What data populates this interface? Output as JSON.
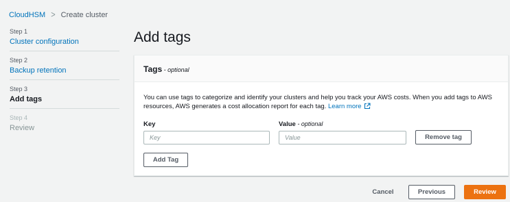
{
  "breadcrumb": {
    "root": "CloudHSM",
    "current": "Create cluster"
  },
  "steps": [
    {
      "num": "Step 1",
      "label": "Cluster configuration",
      "state": "link"
    },
    {
      "num": "Step 2",
      "label": "Backup retention",
      "state": "link"
    },
    {
      "num": "Step 3",
      "label": "Add tags",
      "state": "current"
    },
    {
      "num": "Step 4",
      "label": "Review",
      "state": "disabled"
    }
  ],
  "page_title": "Add tags",
  "panel": {
    "title": "Tags",
    "title_suffix": " - optional",
    "description": "You can use tags to categorize and identify your clusters and help you track your AWS costs. When you add tags to AWS resources, AWS generates a cost allocation report for each tag. ",
    "learn_more": "Learn more",
    "key_label": "Key",
    "value_label": "Value",
    "value_suffix": " - optional",
    "key_placeholder": "Key",
    "value_placeholder": "Value",
    "remove_tag": "Remove tag",
    "add_tag": "Add Tag"
  },
  "footer": {
    "cancel": "Cancel",
    "previous": "Previous",
    "review": "Review"
  },
  "colors": {
    "link": "#0073bb",
    "primary": "#ec7211",
    "background": "#f2f3f3"
  }
}
